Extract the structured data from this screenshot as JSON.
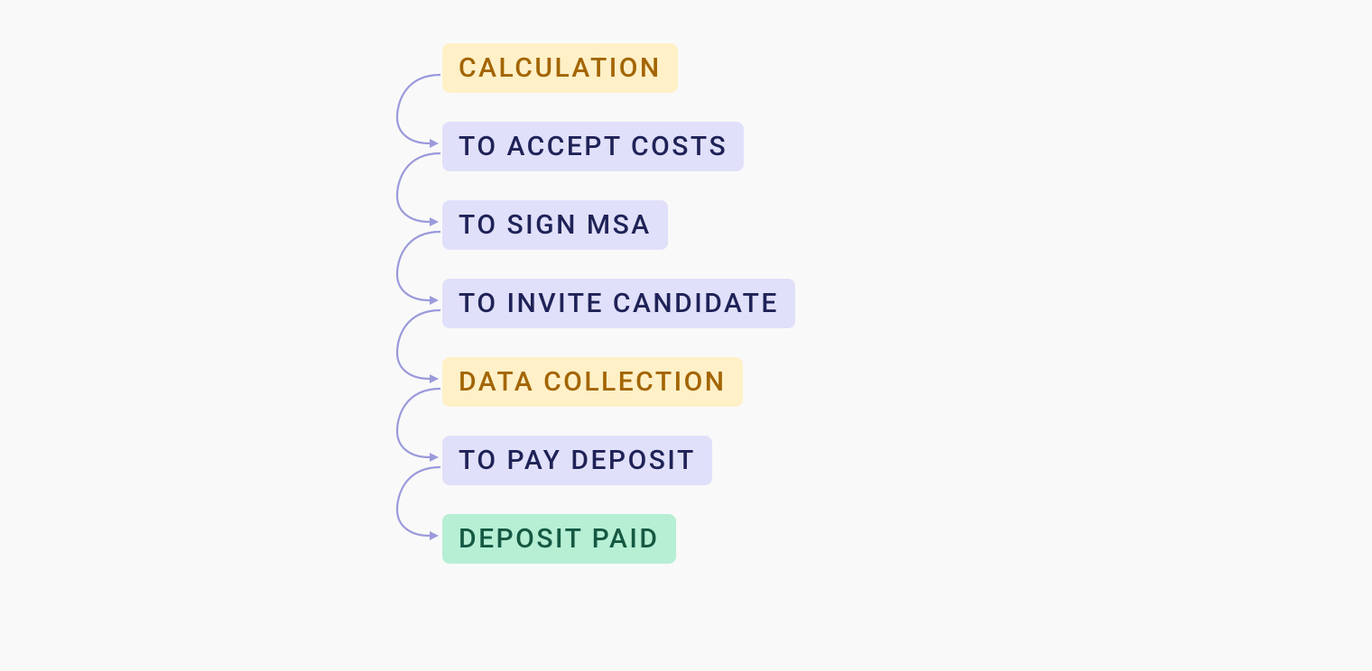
{
  "flow": {
    "steps": [
      {
        "label": "Calculation",
        "style": "orange"
      },
      {
        "label": "To accept costs",
        "style": "purple"
      },
      {
        "label": "To sign MSA",
        "style": "purple"
      },
      {
        "label": "To invite candidate",
        "style": "purple"
      },
      {
        "label": "Data collection",
        "style": "orange"
      },
      {
        "label": "To pay deposit",
        "style": "purple"
      },
      {
        "label": "Deposit paid",
        "style": "green"
      }
    ]
  }
}
